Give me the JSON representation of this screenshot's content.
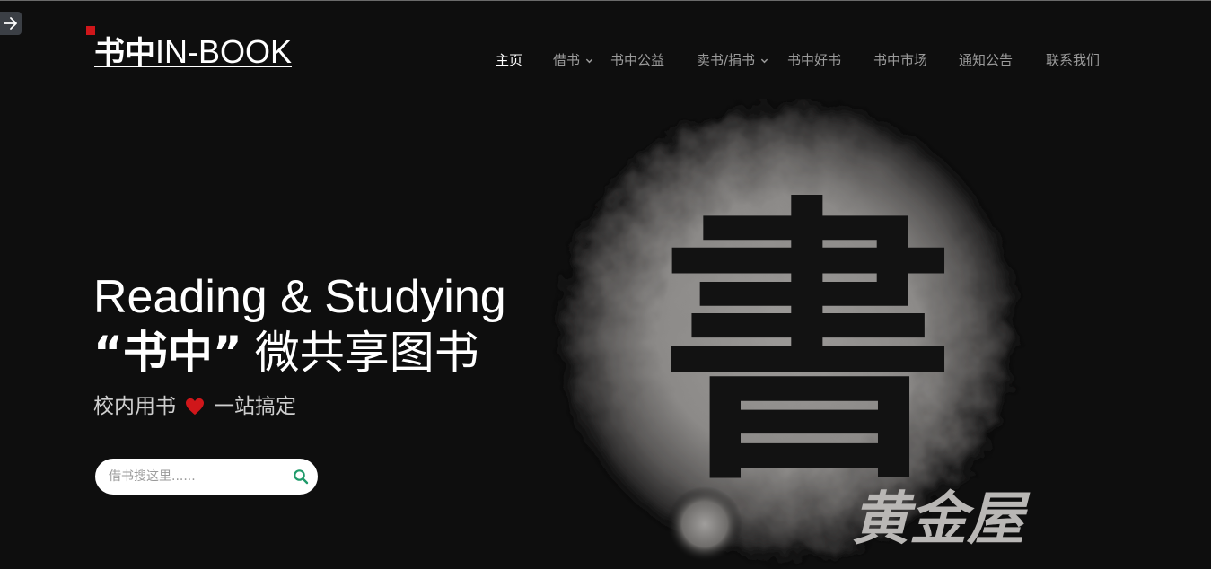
{
  "logo": {
    "cn": "书中",
    "en": "IN-BOOK"
  },
  "nav": {
    "items": [
      {
        "label": "主页",
        "active": true,
        "dropdown": false
      },
      {
        "label": "借书",
        "active": false,
        "dropdown": true
      },
      {
        "label": "书中公益",
        "active": false,
        "dropdown": false
      },
      {
        "label": "卖书/捐书",
        "active": false,
        "dropdown": true
      },
      {
        "label": "书中好书",
        "active": false,
        "dropdown": false
      },
      {
        "label": "书中市场",
        "active": false,
        "dropdown": false
      },
      {
        "label": "通知公告",
        "active": false,
        "dropdown": false
      },
      {
        "label": "联系我们",
        "active": false,
        "dropdown": false
      }
    ]
  },
  "hero": {
    "title_en": "Reading & Studying",
    "title_cn_bold": "“书中”",
    "title_cn_light": "微共享图书",
    "sub_left": "校内用书",
    "sub_right": "一站搞定"
  },
  "search": {
    "placeholder": "借书搜这里......"
  },
  "artwork": {
    "main_char": "書",
    "signature": "黄金屋"
  },
  "colors": {
    "background": "#0e0e0e",
    "accent_red": "#d0161a",
    "search_icon": "#1f9a6a",
    "nav_inactive": "#9a9a9a",
    "nav_active": "#ffffff"
  },
  "icons": {
    "side_button": "arrow-right-icon",
    "search": "search-icon",
    "heart": "heart-icon",
    "dropdown": "chevron-down-icon"
  }
}
